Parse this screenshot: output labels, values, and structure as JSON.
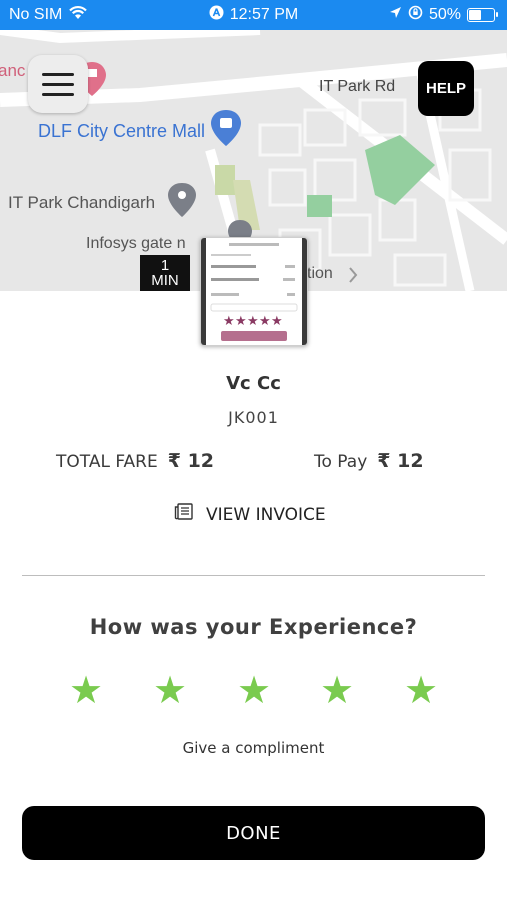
{
  "status_bar": {
    "carrier": "No SIM",
    "time": "12:57 PM",
    "battery": "50%",
    "battery_level": 0.5,
    "icons": [
      "wifi-icon",
      "alarm-icon",
      "location-arrow-icon",
      "orientation-lock-icon",
      "battery-icon"
    ]
  },
  "map": {
    "help_label": "HELP",
    "labels": {
      "it_park_rd": "IT Park Rd",
      "dlf": "DLF City Centre Mall",
      "it_park_chd": "IT Park Chandigarh",
      "infosys": "Infosys gate n",
      "partial_left": "anc",
      "partial_tion": "tion"
    },
    "eta_value": "1",
    "eta_unit": "MIN",
    "colors": {
      "land": "#e7e7e7",
      "roads": "#ffffff",
      "park": "#94cf9f",
      "poi_blue": "#4a7fd6",
      "poi_gray": "#7b7f88",
      "poi_pink": "#e0708a"
    }
  },
  "ride": {
    "driver_name": "Vc Cc",
    "vehicle_code": "JK001",
    "total_fare_label": "TOTAL FARE",
    "total_fare_value": "₹ 12",
    "to_pay_label": "To Pay",
    "to_pay_value": "₹ 12",
    "view_invoice_label": "VIEW INVOICE"
  },
  "rating": {
    "question": "How was your Experience?",
    "stars": 5,
    "star_color": "#7acb4f",
    "compliment_label": "Give a compliment"
  },
  "done_label": "DONE"
}
